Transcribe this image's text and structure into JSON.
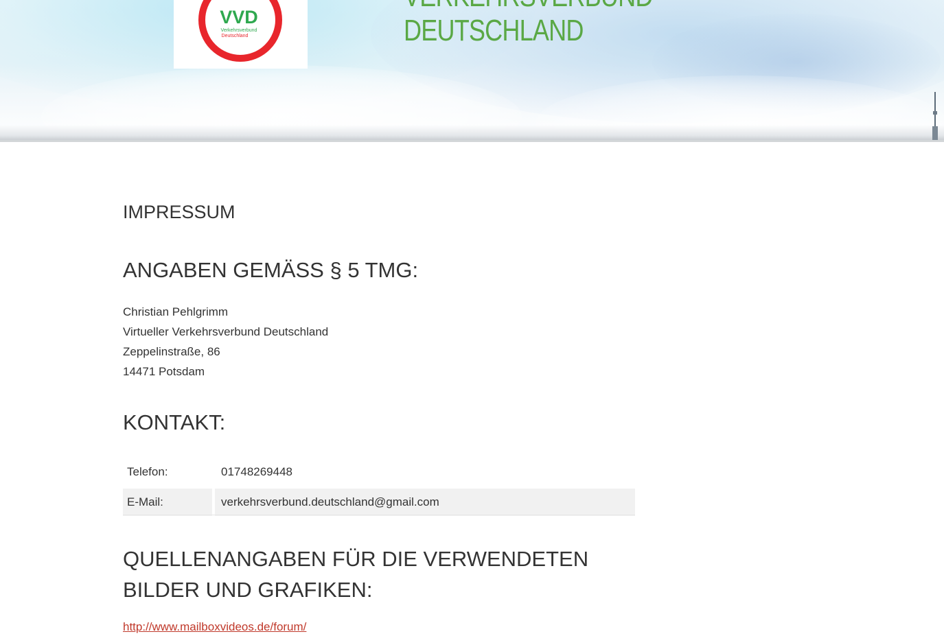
{
  "header": {
    "logo": {
      "abbr": "VVD",
      "line1": "Verkehrsverbund",
      "line2": "Deutschland"
    },
    "title_line1": "VERKEHRSVERBUND",
    "title_line2": "DEUTSCHLAND"
  },
  "main": {
    "page_title": "IMPRESSUM",
    "section_tmg": "ANGABEN GEMÄSS § 5 TMG:",
    "address": {
      "name": "Christian Pehlgrimm",
      "org": "Virtueller Verkehrsverbund Deutschland",
      "street": "Zeppelinstraße, 86",
      "city": "14471 Potsdam"
    },
    "section_contact": "KONTAKT:",
    "contact": [
      {
        "label": "Telefon:",
        "value": "01748269448"
      },
      {
        "label": "E-Mail:",
        "value": "verkehrsverbund.deutschland@gmail.com"
      }
    ],
    "section_sources": "QUELLENANGABEN FÜR DIE VERWENDETEN BILDER UND GRAFIKEN:",
    "source_link": "http://www.mailboxvideos.de/forum/"
  },
  "colors": {
    "title_green": "#5aa845",
    "logo_red": "#e8262c",
    "logo_green": "#2fa84f"
  }
}
